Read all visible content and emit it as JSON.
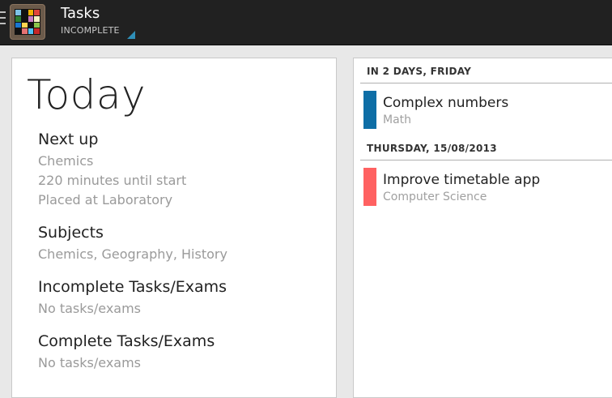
{
  "app": {
    "title": "Tasks",
    "filter": "INCOMPLETE",
    "icon_colors": [
      "#7ec3e6",
      "#111111",
      "#f0b000",
      "#e0443a",
      "#2e7d32",
      "#111111",
      "#c97ac2",
      "#f6f1c4",
      "#1976d2",
      "#ffd54f",
      "#111111",
      "#8bc34a",
      "#111111",
      "#e57373",
      "#4fc3f7",
      "#c62828"
    ]
  },
  "today": {
    "title": "Today",
    "next_up": {
      "heading": "Next up",
      "lines": [
        "Chemics",
        "220 minutes until start",
        "Placed at Laboratory"
      ]
    },
    "subjects": {
      "heading": "Subjects",
      "value": "Chemics, Geography, History"
    },
    "incomplete": {
      "heading": "Incomplete Tasks/Exams",
      "value": "No tasks/exams"
    },
    "complete": {
      "heading": "Complete Tasks/Exams",
      "value": "No tasks/exams"
    }
  },
  "groups": [
    {
      "heading": "IN 2 DAYS, FRIDAY",
      "tasks": [
        {
          "title": "Complex numbers",
          "subject": "Math",
          "color": "#0e6ea6"
        }
      ]
    },
    {
      "heading": "THURSDAY, 15/08/2013",
      "tasks": [
        {
          "title": "Improve timetable app",
          "subject": "Computer Science",
          "color": "#ff6161"
        }
      ]
    }
  ]
}
